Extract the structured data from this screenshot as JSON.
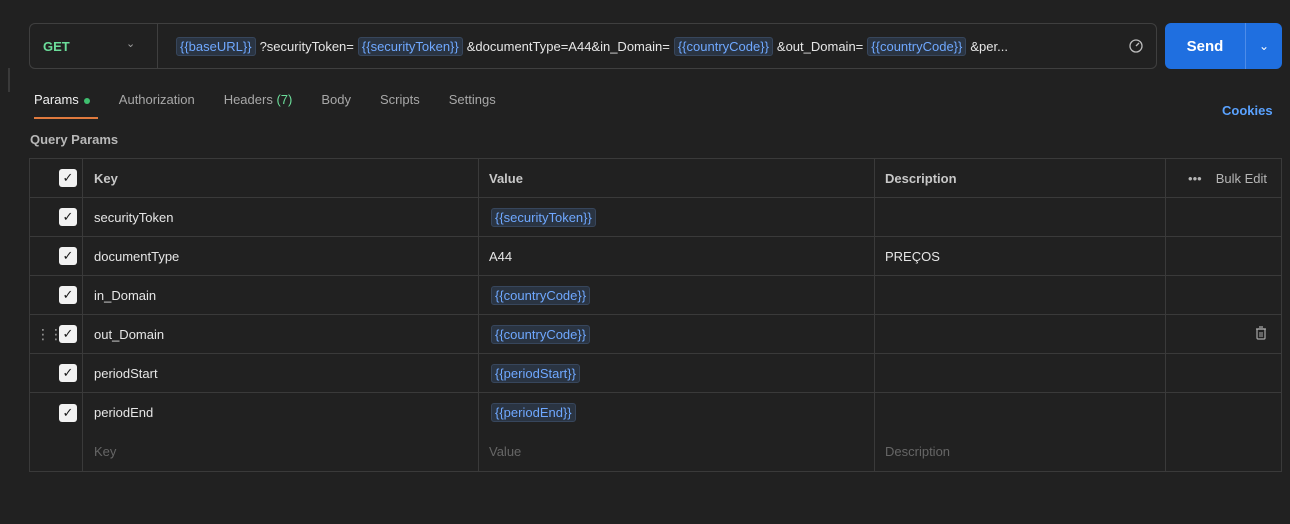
{
  "request": {
    "method": "GET",
    "url_parts": [
      {
        "type": "var",
        "text": "{{baseURL}}"
      },
      {
        "type": "text",
        "text": "?securityToken="
      },
      {
        "type": "var",
        "text": "{{securityToken}}"
      },
      {
        "type": "text",
        "text": "&documentType=A44&in_Domain="
      },
      {
        "type": "var",
        "text": "{{countryCode}}"
      },
      {
        "type": "text",
        "text": "&out_Domain="
      },
      {
        "type": "var",
        "text": "{{countryCode}}"
      },
      {
        "type": "text",
        "text": "&per..."
      }
    ],
    "send_label": "Send"
  },
  "tabs": {
    "params": "Params",
    "authorization": "Authorization",
    "headers": "Headers",
    "headers_count": "(7)",
    "body": "Body",
    "scripts": "Scripts",
    "settings": "Settings",
    "cookies": "Cookies"
  },
  "section_title": "Query Params",
  "table": {
    "headers": {
      "key": "Key",
      "value": "Value",
      "description": "Description",
      "bulk_edit": "Bulk Edit"
    },
    "rows": [
      {
        "key": "securityToken",
        "value": "{{securityToken}}",
        "value_is_var": true,
        "description": ""
      },
      {
        "key": "documentType",
        "value": "A44",
        "value_is_var": false,
        "description": "PREÇOS"
      },
      {
        "key": "in_Domain",
        "value": "{{countryCode}}",
        "value_is_var": true,
        "description": ""
      },
      {
        "key": "out_Domain",
        "value": "{{countryCode}}",
        "value_is_var": true,
        "description": ""
      },
      {
        "key": "periodStart",
        "value": "{{periodStart}}",
        "value_is_var": true,
        "description": ""
      },
      {
        "key": "periodEnd",
        "value": "{{periodEnd}}",
        "value_is_var": true,
        "description": ""
      }
    ],
    "placeholders": {
      "key": "Key",
      "value": "Value",
      "description": "Description"
    }
  },
  "colors": {
    "method": "#6bdd9a",
    "variable": "#6fa8ff",
    "send": "#1f6fe0",
    "active_tab": "#e07a3e",
    "cookies_link": "#5aa2ff"
  }
}
